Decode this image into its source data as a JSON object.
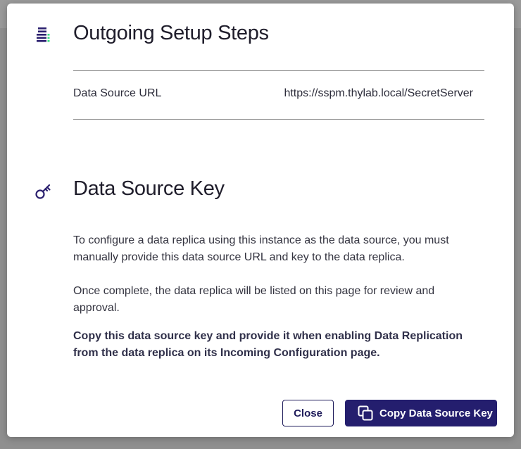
{
  "modal": {
    "setup_title": "Outgoing Setup Steps",
    "key_title": "Data Source Key"
  },
  "details": {
    "url_label": "Data Source URL",
    "url_value": "https://sspm.thylab.local/SecretServer"
  },
  "instructions": {
    "p1": "To configure a data replica using this instance as the data source, you must manually provide this data source URL and key to the data replica.",
    "p2": "Once complete, the data replica will be listed on this page for review and approval.",
    "p3": "Copy this data source key and provide it when enabling Data Replication from the data replica on its Incoming Configuration page."
  },
  "buttons": {
    "close_label": "Close",
    "copy_label": "Copy Data Source Key"
  },
  "icons": {
    "setup": "server-list-icon",
    "key": "key-icon",
    "copy": "copy-icon"
  },
  "colors": {
    "primary": "#241e6e",
    "accent_green": "#3ddc84",
    "icon": "#2a1f6e"
  }
}
